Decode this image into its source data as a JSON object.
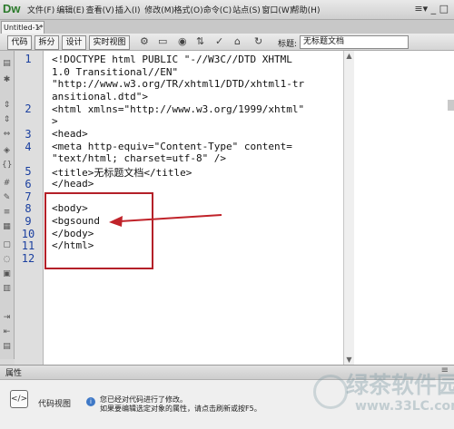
{
  "app": {
    "logo": "Dw",
    "menus": [
      "文件(F)",
      "编辑(E)",
      "查看(V)",
      "插入(I)",
      "修改(M)",
      "格式(O)",
      "命令(C)",
      "站点(S)",
      "窗口(W)",
      "帮助(H)"
    ],
    "window_controls": "≡▾ _ □"
  },
  "tab": {
    "name": "Untitled-1*",
    "close": "×"
  },
  "toolbar": {
    "views": [
      "代码",
      "拆分",
      "设计",
      "实时视图"
    ],
    "title_label": "标题:",
    "title_value": "无标题文档"
  },
  "editor": {
    "line_numbers": [
      "1",
      "2",
      "3",
      "4",
      "5",
      "6",
      "7",
      "8",
      "9",
      "10",
      "11",
      "12"
    ],
    "lines": [
      "<!DOCTYPE html PUBLIC \"-//W3C//DTD XHTML",
      "1.0 Transitional//EN\"",
      "\"http://www.w3.org/TR/xhtml1/DTD/xhtml1-tr",
      "ansitional.dtd\">",
      "<html xmlns=\"http://www.w3.org/1999/xhtml\"",
      ">",
      "<head>",
      "<meta http-equiv=\"Content-Type\" content=",
      "\"text/html; charset=utf-8\" />",
      "<title>无标题文档</title>",
      "</head>",
      "",
      "<body>",
      "<bgsound",
      "</body>",
      "</html>"
    ]
  },
  "properties": {
    "title": "属性",
    "code_view_label": "代码视图",
    "notice": [
      "您已经对代码进行了修改。",
      "如果要编辑选定对象的属性，请点击刷新或按F5。"
    ]
  },
  "watermark": {
    "line1": "绿茶软件园",
    "line2": "www.33LC.com"
  },
  "colors": {
    "line_number": "#1a3f9f",
    "highlight_box": "#b42028",
    "arrow": "#c0232a"
  }
}
